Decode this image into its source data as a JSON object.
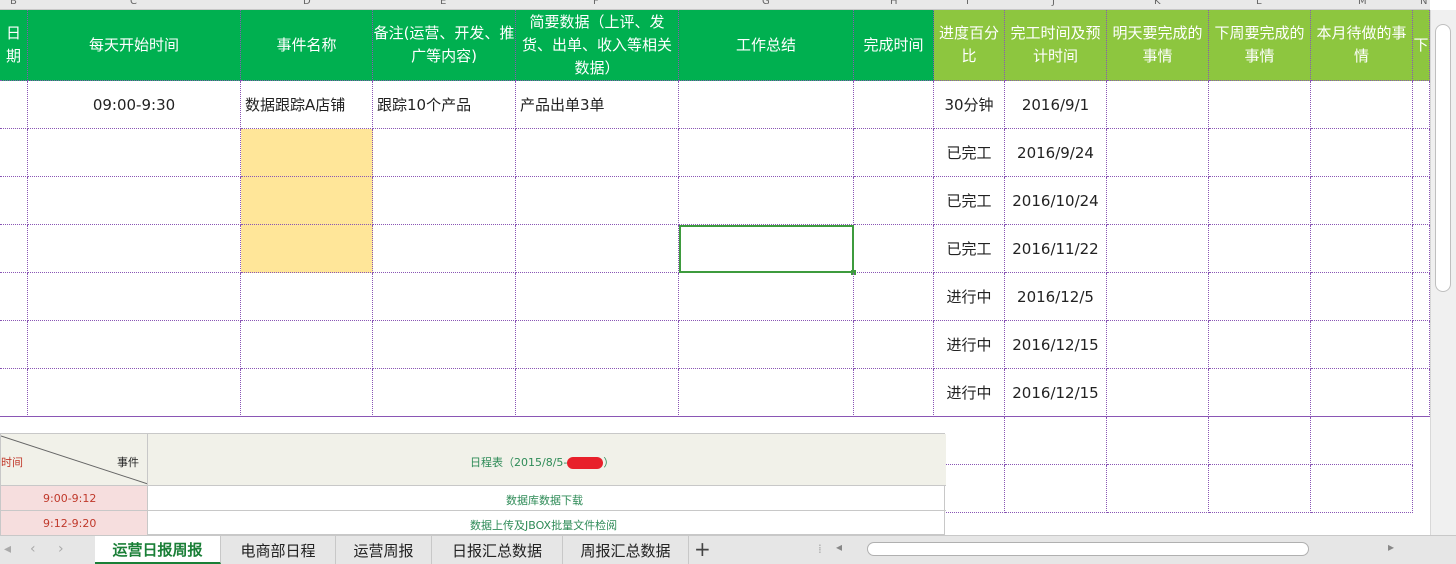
{
  "column_letters": [
    "B",
    "C",
    "D",
    "E",
    "F",
    "G",
    "H",
    "I",
    "J",
    "K",
    "L",
    "M",
    "N"
  ],
  "header": {
    "date": "日期",
    "start_time": "每天开始时间",
    "event_name": "事件名称",
    "remarks": "备注(运营、开发、推广等内容)",
    "brief_data": "简要数据（上评、发货、出单、收入等相关数据）",
    "work_summary": "工作总结",
    "finish_time": "完成时间",
    "progress": "进度百分比",
    "completion": "完工时间及预计时间",
    "tomorrow": "明天要完成的事情",
    "next_week": "下周要完成的事情",
    "this_month": "本月待做的事情",
    "extra": "下"
  },
  "rows": [
    {
      "start_time": "09:00-9:30",
      "event_name": "数据跟踪A店铺",
      "remarks": "跟踪10个产品",
      "brief_data": "产品出单3单",
      "progress": "30分钟",
      "completion": "2016/9/1"
    },
    {
      "start_time": "",
      "event_name": "",
      "remarks": "",
      "brief_data": "",
      "progress": "已完工",
      "completion": "2016/9/24"
    },
    {
      "start_time": "",
      "event_name": "",
      "remarks": "",
      "brief_data": "",
      "progress": "已完工",
      "completion": "2016/10/24"
    },
    {
      "start_time": "",
      "event_name": "",
      "remarks": "",
      "brief_data": "",
      "progress": "已完工",
      "completion": "2016/11/22"
    },
    {
      "start_time": "",
      "event_name": "",
      "remarks": "",
      "brief_data": "",
      "progress": "进行中",
      "completion": "2016/12/5"
    },
    {
      "start_time": "",
      "event_name": "",
      "remarks": "",
      "brief_data": "",
      "progress": "进行中",
      "completion": "2016/12/15"
    },
    {
      "start_time": "",
      "event_name": "",
      "remarks": "",
      "brief_data": "",
      "progress": "进行中",
      "completion": "2016/12/15"
    }
  ],
  "embedded_image": {
    "corner_time": "时间",
    "corner_event": "事件",
    "title": "日程表（2015/8/5-",
    "title_end": "）",
    "rows": [
      {
        "time": "9:00-9:12",
        "task": "数据库数据下载"
      },
      {
        "time": "9:12-9:20",
        "task": "数据上传及JBOX批量文件检阅"
      }
    ]
  },
  "sheet_tabs": [
    "运营日报周报",
    "电商部日程",
    "运营周报",
    "日报汇总数据",
    "周报汇总数据"
  ],
  "active_tab": "运营日报周报",
  "add_sheet": "+",
  "colors": {
    "header_green": "#00b050",
    "header_lightgreen": "#8dc63f",
    "highlight_yellow": "#ffe699",
    "active_tab": "#1a7f37"
  }
}
